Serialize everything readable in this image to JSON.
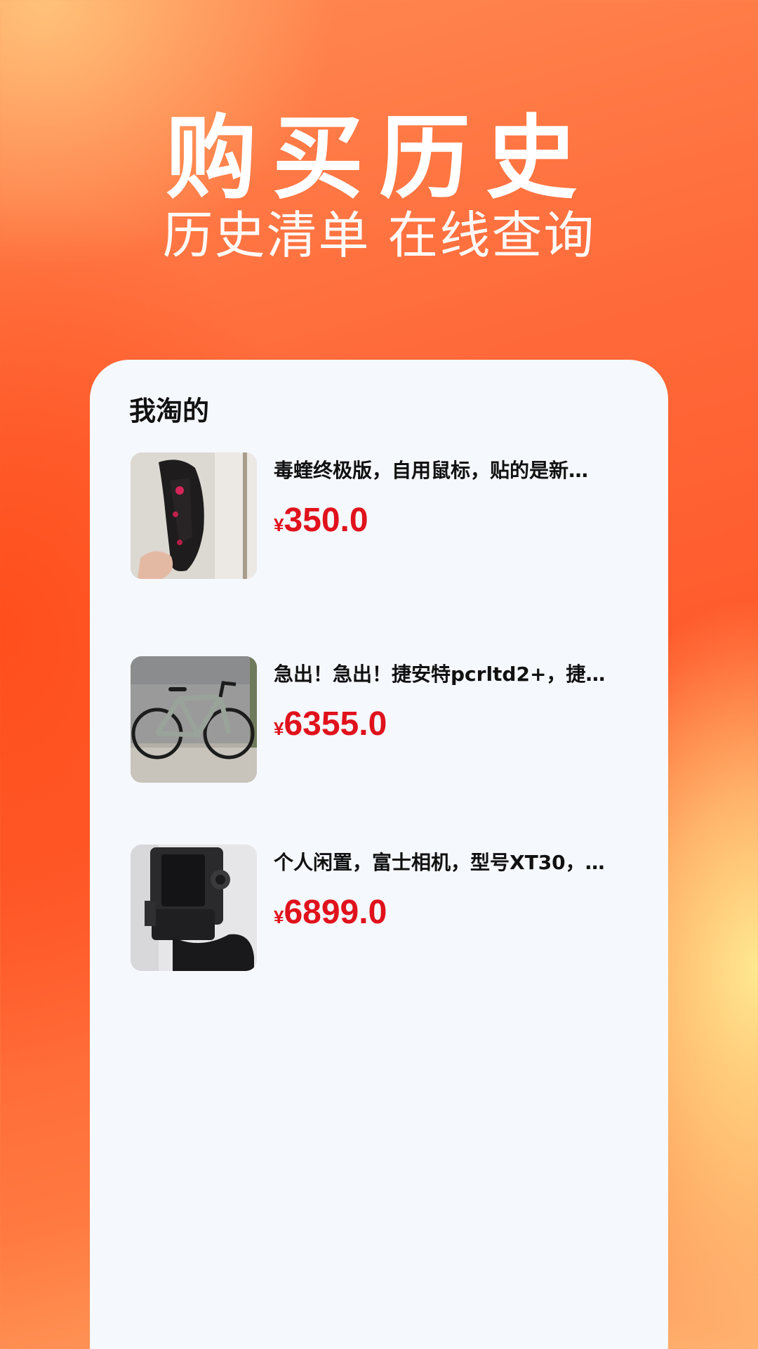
{
  "hero": {
    "title": "购买历史",
    "subtitle": "历史清单 在线查询"
  },
  "card": {
    "title": "我淘的"
  },
  "products": [
    {
      "name": "毒蝰终极版，自用鼠标，贴的是新…",
      "currency": "¥",
      "price": "350.0",
      "image": "mouse-photo"
    },
    {
      "name": "急出！急出！捷安特pcrltd2+，捷…",
      "currency": "¥",
      "price": "6355.0",
      "image": "bicycle-photo"
    },
    {
      "name": "个人闲置，富士相机，型号XT30，…",
      "currency": "¥",
      "price": "6899.0",
      "image": "camera-photo"
    }
  ],
  "colors": {
    "price": "#e0121c",
    "card_background": "#f5f8fc",
    "hero_text": "#ffffff"
  }
}
